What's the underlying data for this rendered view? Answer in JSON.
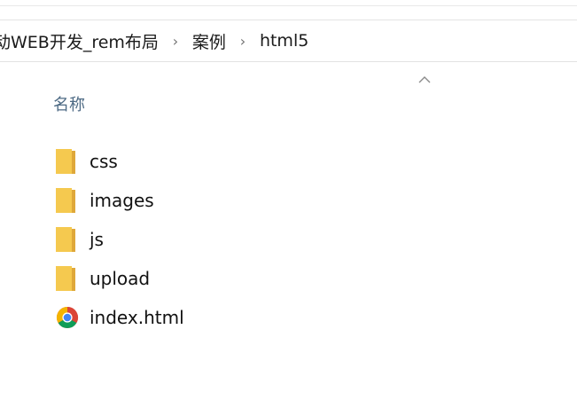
{
  "breadcrumb": {
    "items": [
      "动WEB开发_rem布局",
      "案例",
      "html5"
    ],
    "separator": "›"
  },
  "column_header": {
    "name_label": "名称",
    "sort_icon": "chevron-up-icon"
  },
  "files": [
    {
      "name": "css",
      "type": "folder",
      "icon": "folder-icon"
    },
    {
      "name": "images",
      "type": "folder",
      "icon": "folder-icon"
    },
    {
      "name": "js",
      "type": "folder",
      "icon": "folder-icon"
    },
    {
      "name": "upload",
      "type": "folder",
      "icon": "folder-icon"
    },
    {
      "name": "index.html",
      "type": "html-file",
      "icon": "chrome-icon"
    }
  ],
  "colors": {
    "folder": "#f5c94f",
    "folder_dark": "#dfa83a",
    "header_text": "#4d6a84",
    "separator": "#707070"
  }
}
